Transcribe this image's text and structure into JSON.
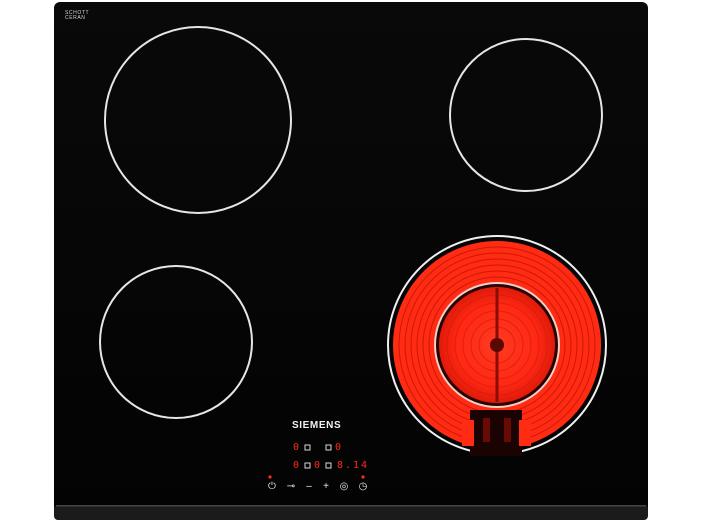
{
  "brand": {
    "glass_line1": "SCHOTT",
    "glass_line2": "CERAN",
    "appliance": "SIEMENS"
  },
  "zones": {
    "lit_color": "#ff2b12",
    "ring_color": "#e6e6e6",
    "glass_color": "#050505",
    "state": "rear-left off, rear-right off, front-left off, front-right on (dual circuit)"
  },
  "display": {
    "rear_left": "0",
    "rear_right": "0",
    "front_left": "0",
    "front_right": "0",
    "timer": "8.14"
  },
  "controls": [
    {
      "name": "power-icon",
      "glyph": "⏻"
    },
    {
      "name": "key-lock-icon",
      "glyph": "⊸"
    },
    {
      "name": "minus-icon",
      "glyph": "–"
    },
    {
      "name": "plus-icon",
      "glyph": "+"
    },
    {
      "name": "dual-zone-icon",
      "glyph": "◎"
    },
    {
      "name": "timer-icon",
      "glyph": "◷"
    }
  ]
}
